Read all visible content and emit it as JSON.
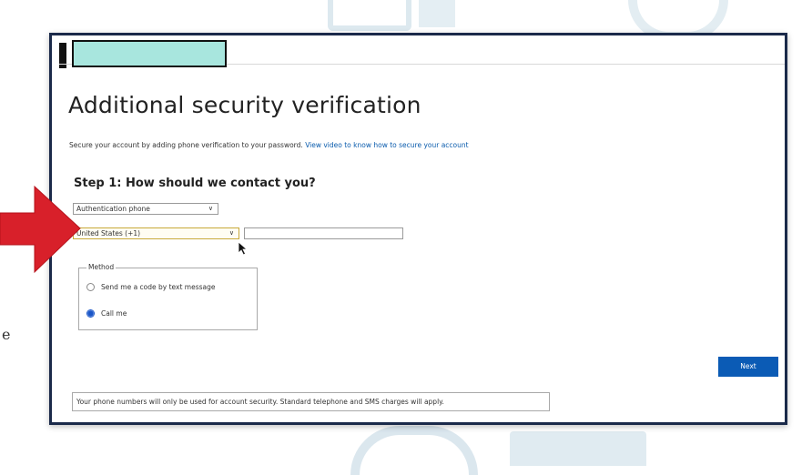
{
  "title": "Additional security verification",
  "description": {
    "text": "Secure your account by adding phone verification to your password.",
    "link": "View video to know how to secure your account"
  },
  "step_heading": "Step 1: How should we contact you?",
  "contact_method": {
    "selected": "Authentication phone"
  },
  "country": {
    "selected": "United States (+1)"
  },
  "phone_input": {
    "value": ""
  },
  "method_group": {
    "legend": "Method",
    "options": [
      {
        "label": "Send me a code by text message",
        "selected": false
      },
      {
        "label": "Call me",
        "selected": true
      }
    ]
  },
  "next_button": "Next",
  "footer_note": "Your phone numbers will only be used for account security. Standard telephone and SMS charges will apply.",
  "side_text": "e",
  "colors": {
    "primary_button": "#0b5bb5",
    "link": "#0b5cad",
    "arrow": "#d8202a",
    "logo_fill": "#a8e6de",
    "window_border": "#1b2a4a"
  },
  "icons": [
    "red-arrow-icon",
    "chevron-down-icon",
    "mouse-cursor-icon"
  ]
}
